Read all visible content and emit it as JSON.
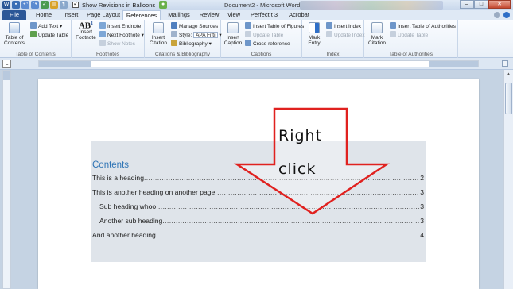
{
  "titlebar": {
    "quick_access_text": "Show Revisions in Balloons",
    "document_title": "Document2 - Microsoft Word"
  },
  "tabs": [
    "File",
    "Home",
    "Insert",
    "Page Layout",
    "References",
    "Mailings",
    "Review",
    "View",
    "PerfectIt 3",
    "Acrobat"
  ],
  "active_tab": "References",
  "ribbon": {
    "toc_group": {
      "toc_button": "Table of\nContents",
      "add_text": "Add Text",
      "update_table": "Update Table",
      "label": "Table of Contents"
    },
    "footnotes_group": {
      "ab_symbol": "AB",
      "insert_footnote": "Insert\nFootnote",
      "insert_endnote": "Insert Endnote",
      "next_footnote": "Next Footnote",
      "show_notes": "Show Notes",
      "label": "Footnotes"
    },
    "citations_group": {
      "insert_citation": "Insert\nCitation",
      "manage_sources": "Manage Sources",
      "style_label": "Style:",
      "style_value": "APA Fifti",
      "bibliography": "Bibliography",
      "label": "Citations & Bibliography"
    },
    "captions_group": {
      "insert_caption": "Insert\nCaption",
      "insert_tof": "Insert Table of Figures",
      "update_table": "Update Table",
      "cross_reference": "Cross-reference",
      "label": "Captions"
    },
    "index_group": {
      "mark_entry": "Mark\nEntry",
      "insert_index": "Insert Index",
      "update_index": "Update Index",
      "label": "Index"
    },
    "toa_group": {
      "mark_citation": "Mark\nCitation",
      "insert_toa": "Insert Table of Authorities",
      "update_table": "Update Table",
      "label": "Table of Authorities"
    }
  },
  "toc": {
    "title": "Contents",
    "entries": [
      {
        "text": "This is a heading",
        "page": "2",
        "level": 1
      },
      {
        "text": "This is another heading on another page",
        "page": "3",
        "level": 1
      },
      {
        "text": "Sub heading whoo",
        "page": "3",
        "level": 2
      },
      {
        "text": "Another sub heading",
        "page": "3",
        "level": 2
      },
      {
        "text": "And another heading",
        "page": "4",
        "level": 1
      }
    ]
  },
  "annotation": {
    "line1": "Right",
    "line2": "click",
    "arrow_color": "#e0211f"
  },
  "colors": {
    "file_tab": "#2b5797",
    "toc_title": "#2e74b5",
    "toc_background": "#dfe4ea"
  }
}
